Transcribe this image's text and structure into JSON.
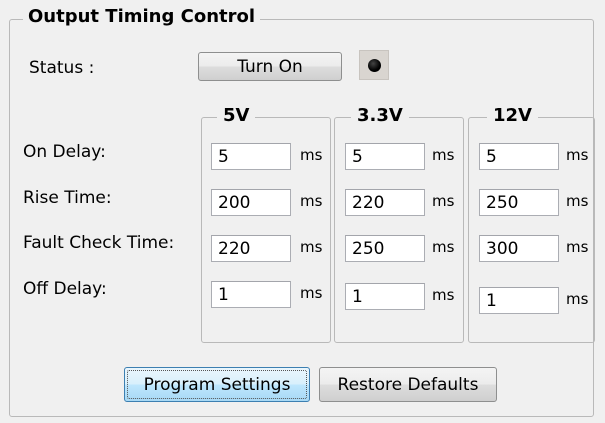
{
  "panel": {
    "title": "Output Timing Control",
    "status_label": "Status :",
    "turn_on_label": "Turn On",
    "led_color": "#000000"
  },
  "rows": {
    "on_delay": "On Delay:",
    "rise_time": "Rise Time:",
    "fault_check_time": "Fault Check Time:",
    "off_delay": "Off Delay:"
  },
  "unit": "ms",
  "groups": [
    {
      "title": "5V",
      "on_delay": "5",
      "rise_time": "200",
      "fault_check_time": "220",
      "off_delay": "1"
    },
    {
      "title": "3.3V",
      "on_delay": "5",
      "rise_time": "220",
      "fault_check_time": "250",
      "off_delay": "1"
    },
    {
      "title": "12V",
      "on_delay": "5",
      "rise_time": "250",
      "fault_check_time": "300",
      "off_delay": "1"
    }
  ],
  "buttons": {
    "program": "Program Settings",
    "restore": "Restore Defaults"
  }
}
